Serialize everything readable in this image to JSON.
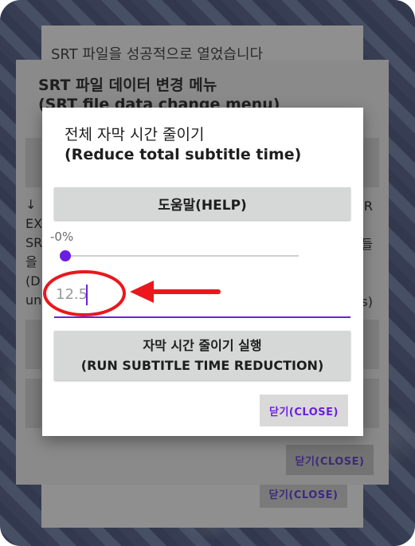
{
  "background_dialog_2": {
    "message": "SRT 파일을 성공적으로 열었습니다",
    "close_label": "닫기(CLOSE)"
  },
  "background_dialog_1": {
    "title_ko": "SRT 파일 데이터 변경 메뉴",
    "title_en": "(SRT file data change menu)",
    "left_fragment": "↓\nEX\nSR\n을\n(D\nun",
    "right_fragment": "R\n\n들\n\n\ns)",
    "close_label": "닫기(CLOSE)"
  },
  "dialog": {
    "title_ko": "전체 자막 시간 줄이기",
    "title_en": "(Reduce total subtitle time)",
    "help_label": "도움말(HELP)",
    "percent_label": "-0%",
    "slider_value_percent": 0,
    "input_value": "12.5",
    "run_label_ko": "자막 시간 줄이기 실행",
    "run_label_en": "(RUN SUBTITLE TIME REDUCTION)",
    "close_label": "닫기(CLOSE)"
  },
  "colors": {
    "accent": "#6a1fe0",
    "annotation": "#e8181e"
  }
}
